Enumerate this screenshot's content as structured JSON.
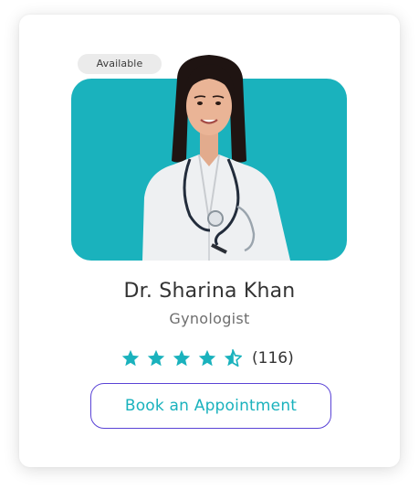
{
  "card": {
    "badge": "Available",
    "name": "Dr. Sharina Khan",
    "specialty": "Gynologist",
    "rating": {
      "value": 4.5,
      "max": 5,
      "count": "(116)"
    },
    "book_label": "Book an Appointment"
  },
  "icons": {
    "star_full": "star-icon",
    "star_half": "star-half-icon"
  },
  "colors": {
    "accent": "#1ab2bd",
    "button_border": "#5a43d6",
    "badge_bg": "#ebebeb"
  }
}
